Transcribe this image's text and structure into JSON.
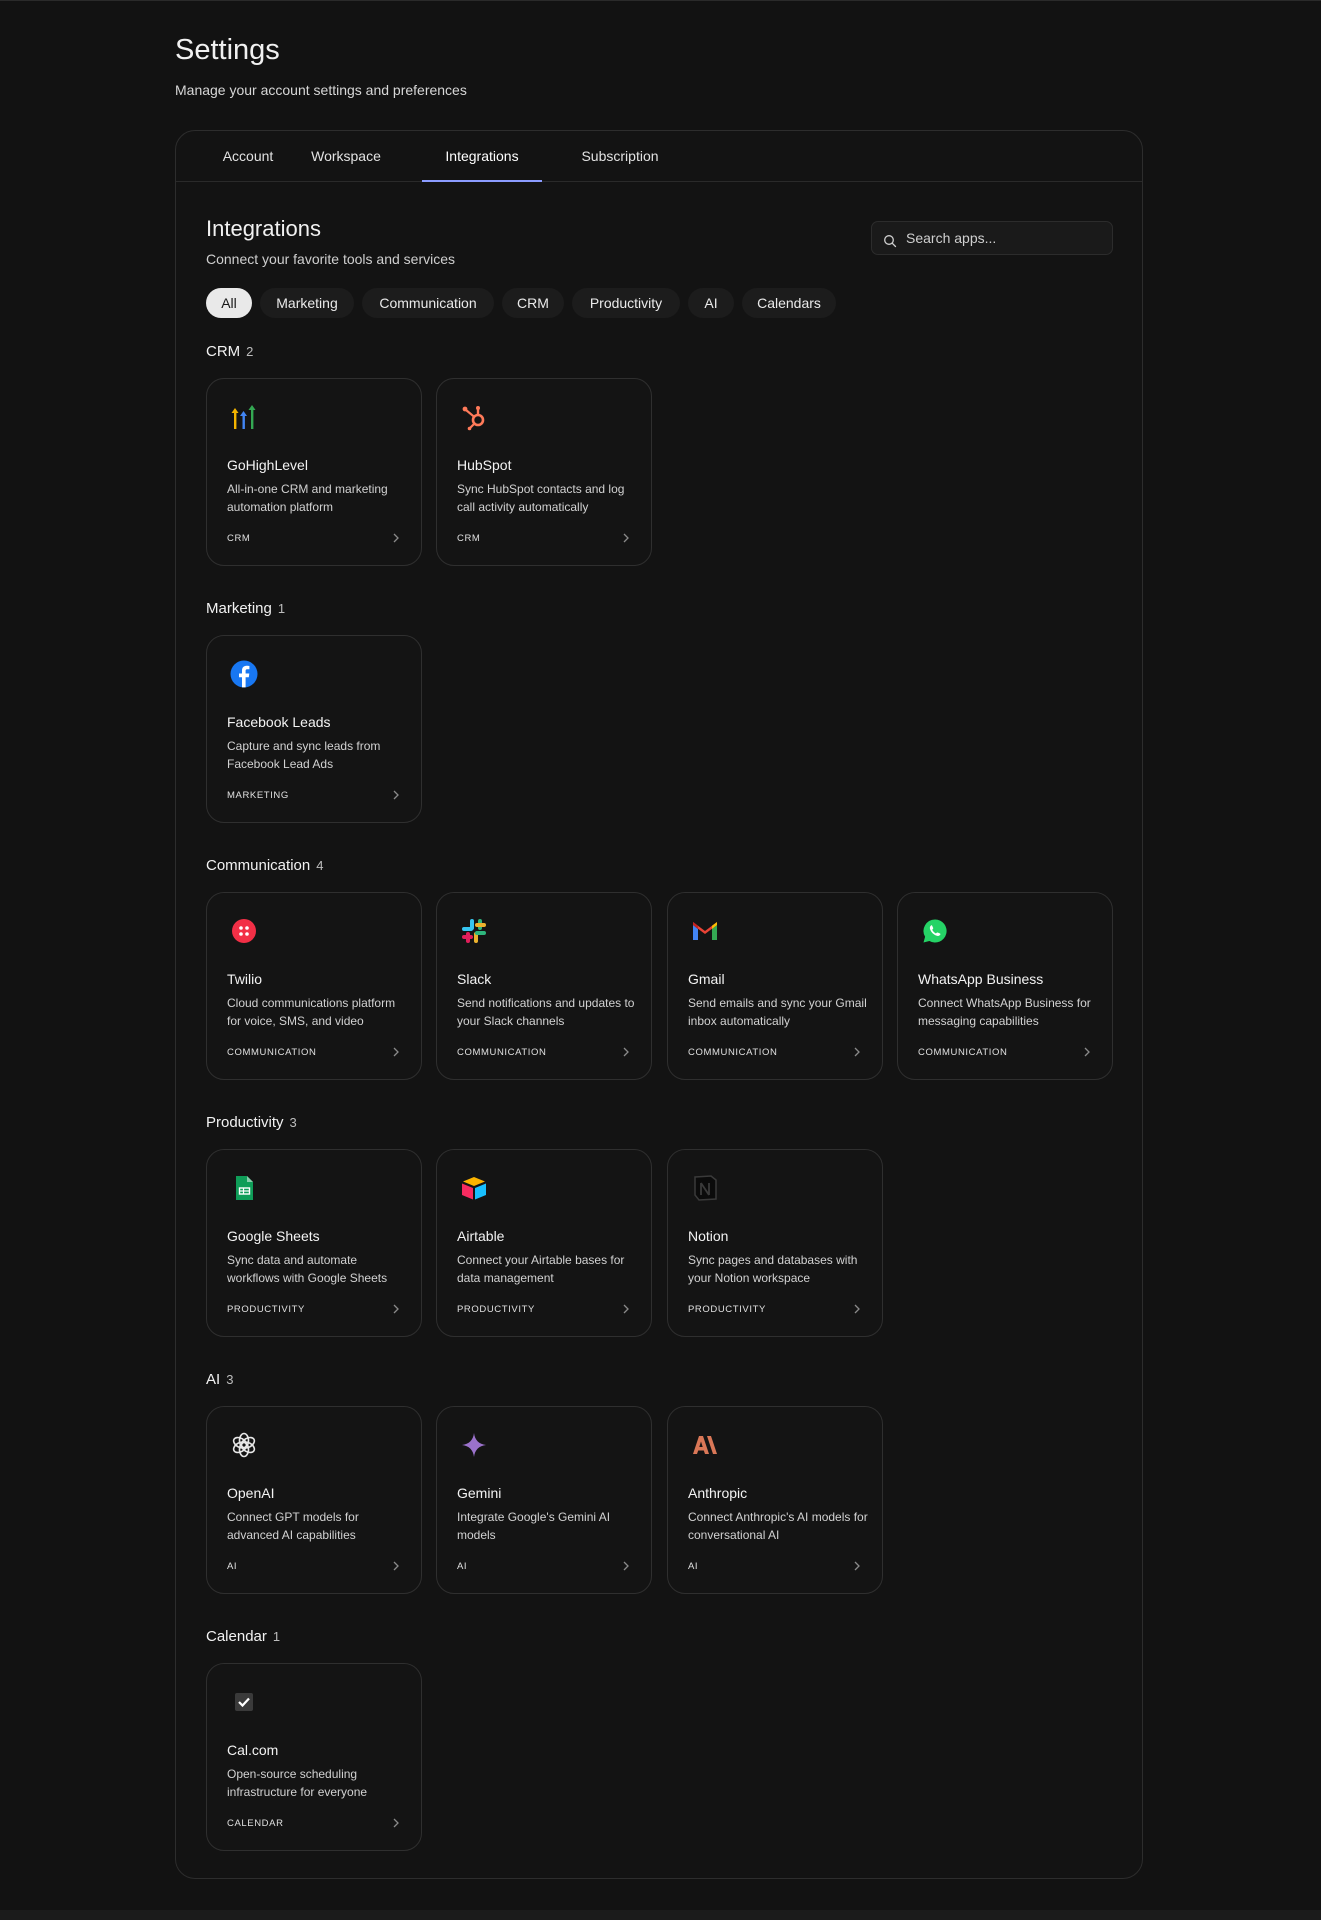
{
  "page": {
    "title": "Settings",
    "subtitle": "Manage your account settings and preferences"
  },
  "tabs": [
    {
      "label": "Account",
      "active": false
    },
    {
      "label": "Workspace",
      "active": false
    },
    {
      "label": "Integrations",
      "active": true
    },
    {
      "label": "Subscription",
      "active": false
    }
  ],
  "integrations": {
    "title": "Integrations",
    "description": "Connect your favorite tools and services",
    "search_placeholder": "Search apps...",
    "filters": [
      {
        "label": "All",
        "active": true
      },
      {
        "label": "Marketing",
        "active": false
      },
      {
        "label": "Communication",
        "active": false
      },
      {
        "label": "CRM",
        "active": false
      },
      {
        "label": "Productivity",
        "active": false
      },
      {
        "label": "AI",
        "active": false
      },
      {
        "label": "Calendars",
        "active": false
      }
    ]
  },
  "sections": [
    {
      "title": "CRM",
      "count": "2",
      "apps": [
        {
          "name": "GoHighLevel",
          "desc": "All-in-one CRM and marketing automation platform",
          "category": "CRM",
          "icon": "gohighlevel-icon"
        },
        {
          "name": "HubSpot",
          "desc": "Sync HubSpot contacts and log call activity automatically",
          "category": "CRM",
          "icon": "hubspot-icon"
        }
      ]
    },
    {
      "title": "Marketing",
      "count": "1",
      "apps": [
        {
          "name": "Facebook Leads",
          "desc": "Capture and sync leads from Facebook Lead Ads",
          "category": "MARKETING",
          "icon": "facebook-icon"
        }
      ]
    },
    {
      "title": "Communication",
      "count": "4",
      "apps": [
        {
          "name": "Twilio",
          "desc": "Cloud communications platform for voice, SMS, and video",
          "category": "COMMUNICATION",
          "icon": "twilio-icon"
        },
        {
          "name": "Slack",
          "desc": "Send notifications and updates to your Slack channels",
          "category": "COMMUNICATION",
          "icon": "slack-icon"
        },
        {
          "name": "Gmail",
          "desc": "Send emails and sync your Gmail inbox automatically",
          "category": "COMMUNICATION",
          "icon": "gmail-icon"
        },
        {
          "name": "WhatsApp Business",
          "desc": "Connect WhatsApp Business for messaging capabilities",
          "category": "COMMUNICATION",
          "icon": "whatsapp-icon"
        }
      ]
    },
    {
      "title": "Productivity",
      "count": "3",
      "apps": [
        {
          "name": "Google Sheets",
          "desc": "Sync data and automate workflows with Google Sheets",
          "category": "PRODUCTIVITY",
          "icon": "google-sheets-icon"
        },
        {
          "name": "Airtable",
          "desc": "Connect your Airtable bases for data management",
          "category": "PRODUCTIVITY",
          "icon": "airtable-icon"
        },
        {
          "name": "Notion",
          "desc": "Sync pages and databases with your Notion workspace",
          "category": "PRODUCTIVITY",
          "icon": "notion-icon"
        }
      ]
    },
    {
      "title": "AI",
      "count": "3",
      "apps": [
        {
          "name": "OpenAI",
          "desc": "Connect GPT models for advanced AI capabilities",
          "category": "AI",
          "icon": "openai-icon"
        },
        {
          "name": "Gemini",
          "desc": "Integrate Google's Gemini AI models",
          "category": "AI",
          "icon": "gemini-icon"
        },
        {
          "name": "Anthropic",
          "desc": "Connect Anthropic's AI models for conversational AI",
          "category": "AI",
          "icon": "anthropic-icon"
        }
      ]
    },
    {
      "title": "Calendar",
      "count": "1",
      "apps": [
        {
          "name": "Cal.com",
          "desc": "Open-source scheduling infrastructure for everyone",
          "category": "CALENDAR",
          "icon": "calcom-icon"
        }
      ]
    }
  ]
}
